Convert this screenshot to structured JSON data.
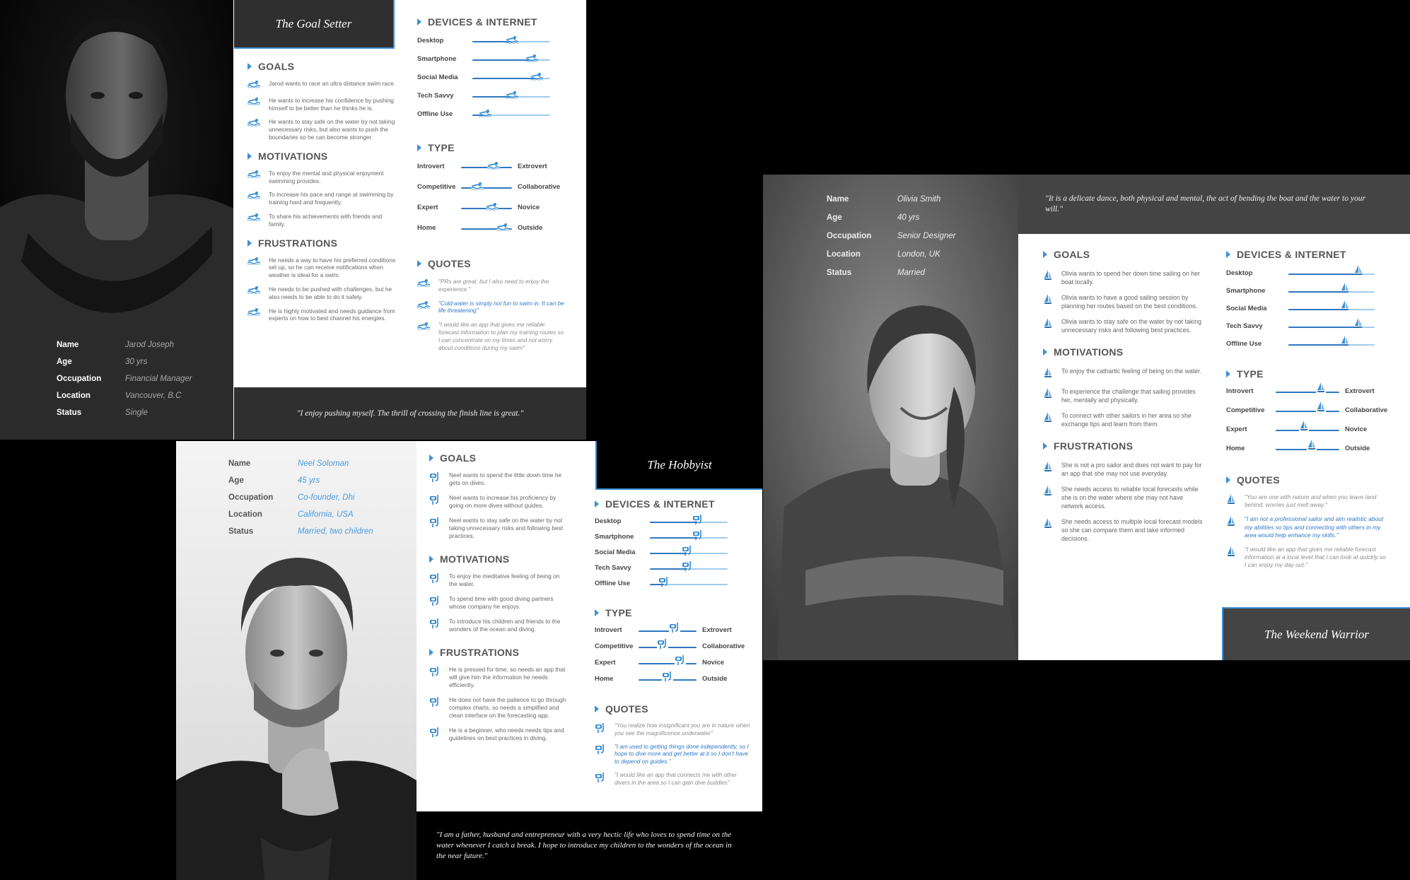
{
  "colors": {
    "accent": "#3b8fd6",
    "dark_panel": "#2f2f2f",
    "card_bg": "#ffffff",
    "hobbyist_value": "#4a9be0"
  },
  "info_keys": [
    "Name",
    "Age",
    "Occupation",
    "Location",
    "Status"
  ],
  "goal_setter": {
    "title": "The Goal Setter",
    "profile": {
      "name": "Jarod Joseph",
      "age": "30 yrs",
      "occupation": "Financial Manager",
      "location": "Vancouver, B.C",
      "status": "Single"
    },
    "sections": {
      "goals": "GOALS",
      "motivations": "MOTIVATIONS",
      "frustrations": "FRUSTRATIONS",
      "devices": "DEVICES & INTERNET",
      "type": "TYPE",
      "quotes": "QUOTES"
    },
    "icon": "swimmer-icon",
    "goals": [
      "Jarod wants to race an ultra distance swim race.",
      "He wants to increase his confidence by pushing himself to be better than he thinks he is.",
      "He wants to stay safe on the water by not taking unnecessary risks, but also wants to push the boundaries so he can become stronger."
    ],
    "motivations": [
      "To enjoy the mental and physical enjoyment swimming provides.",
      "To increase his pace and range at swimming by training hard and frequently.",
      "To share his achievements with friends and family."
    ],
    "frustrations": [
      "He needs a way to have his preferred conditions set up, so he can receive notifications when weather is ideal for a swim.",
      "He needs to be pushed with challenges, but he also needs to be able to do it safely.",
      "He is highly motivated and needs guidance from experts on how to best channel his energies."
    ],
    "devices": [
      {
        "label": "Desktop",
        "level": 0.5
      },
      {
        "label": "Smartphone",
        "level": 0.75
      },
      {
        "label": "Social Media",
        "level": 0.82
      },
      {
        "label": "Tech Savvy",
        "level": 0.5
      },
      {
        "label": "Offline Use",
        "level": 0.15
      }
    ],
    "type": [
      {
        "left": "Introvert",
        "right": "Extrovert",
        "level": 0.62
      },
      {
        "left": "Competitive",
        "right": "Collaborative",
        "level": 0.3
      },
      {
        "left": "Expert",
        "right": "Novice",
        "level": 0.6
      },
      {
        "left": "Home",
        "right": "Outside",
        "level": 0.8
      }
    ],
    "quotes": [
      {
        "text": "\"PRs are great, but I also need to enjoy the experience.\"",
        "highlight": false
      },
      {
        "text": "\"Cold water is simply not fun to swim in. It can be life threatening\"",
        "highlight": true
      },
      {
        "text": "\"I would like an app that gives me reliable forecast information to plan my training routes so I can concentrate on my times and not worry about conditions during my swim\"",
        "highlight": false
      }
    ],
    "footer_quote": "\"I enjoy pushing myself. The thrill of crossing the finish line is great.\""
  },
  "hobbyist": {
    "title": "The Hobbyist",
    "profile": {
      "name": "Neel Soloman",
      "age": "45 yrs",
      "occupation": "Co-founder, Dhi",
      "location": "California, USA",
      "status": "Married, two children"
    },
    "sections": {
      "goals": "GOALS",
      "motivations": "MOTIVATIONS",
      "frustrations": "FRUSTRATIONS",
      "devices": "DEVICES & INTERNET",
      "type": "TYPE",
      "quotes": "QUOTES"
    },
    "icon": "diver-icon",
    "goals": [
      "Neel wants to spend the little down time he gets on dives.",
      "Neel wants to increase his proficiency by going on more dives without guides.",
      "Neel wants to stay safe on the water by not taking unnecessary risks and following best practices."
    ],
    "motivations": [
      "To enjoy the meditative feeling of being on the water.",
      "To spend time with good diving partners whose company he enjoys.",
      "To introduce his children and friends to the wonders of the ocean and diving."
    ],
    "frustrations": [
      "He is pressed for time, so needs an app that will give him the information he needs efficiently.",
      "He does not have the patience to go through complex charts, so needs a simplified and clean interface on the forecasting app.",
      "He is a beginner, who needs needs tips and guidelines on best practices in diving."
    ],
    "devices": [
      {
        "label": "Desktop",
        "level": 0.62
      },
      {
        "label": "Smartphone",
        "level": 0.62
      },
      {
        "label": "Social Media",
        "level": 0.48
      },
      {
        "label": "Tech Savvy",
        "level": 0.48
      },
      {
        "label": "Offline Use",
        "level": 0.18
      }
    ],
    "type": [
      {
        "left": "Introvert",
        "right": "Extrovert",
        "level": 0.62
      },
      {
        "left": "Competitive",
        "right": "Collaborative",
        "level": 0.42
      },
      {
        "left": "Expert",
        "right": "Novice",
        "level": 0.72
      },
      {
        "left": "Home",
        "right": "Outside",
        "level": 0.5
      }
    ],
    "quotes": [
      {
        "text": "\"You realize how insignificant you are in nature when you see the magnificence underwater\"",
        "highlight": false
      },
      {
        "text": "\"I am used to getting things done independently, so I hope to dive more and get better at it so I don't have to depend on guides.\"",
        "highlight": true
      },
      {
        "text": "\"I would like an app that connects me with other divers in the area so I can gain dive buddies\"",
        "highlight": false
      }
    ],
    "footer_quote": "\"I am a father, husband and entrepreneur with a very hectic life who loves to spend time on the water whenever I catch a break. I hope to introduce my children to the wonders of the ocean in the near future.\""
  },
  "weekend_warrior": {
    "title": "The Weekend Warrior",
    "profile": {
      "name": "Olivia Smith",
      "age": "40 yrs",
      "occupation": "Senior Designer",
      "location": "London, UK",
      "status": "Married"
    },
    "sections": {
      "goals": "GOALS",
      "motivations": "MOTIVATIONS",
      "frustrations": "FRUSTRATIONS",
      "devices": "DEVICES & INTERNET",
      "type": "TYPE",
      "quotes": "QUOTES"
    },
    "icon": "sailboat-icon",
    "header_quote": "\"It is a delicate dance, both physical and mental, the act of bending the boat and the water to your will.\"",
    "goals": [
      "Olivia wants to spend her down time sailing on her boat locally.",
      "Olivia wants to have a good sailing session by planning her routes based on the best conditions.",
      "Olivia wants to stay safe on the water by not taking unnecessary risks and following best practices."
    ],
    "motivations": [
      "To enjoy the cathartic feeling of being on the water.",
      "To experience the challenge that sailing provides her, mentally and physically.",
      "To connect with other sailors in her area so she exchange tips and learn from them."
    ],
    "frustrations": [
      "She is not a pro sailor and does not want to pay for an app that she may not use everyday.",
      "She needs access to reliable local forecasts while she is on the water where she may not have network access.",
      "She needs access to multiple local forecast models so she can compare them and take informed decisions."
    ],
    "devices": [
      {
        "label": "Desktop",
        "level": 0.82
      },
      {
        "label": "Smartphone",
        "level": 0.66
      },
      {
        "label": "Social Media",
        "level": 0.66
      },
      {
        "label": "Tech Savvy",
        "level": 0.82
      },
      {
        "label": "Offline Use",
        "level": 0.66
      }
    ],
    "type": [
      {
        "left": "Introvert",
        "right": "Extrovert",
        "level": 0.72
      },
      {
        "left": "Competitive",
        "right": "Collaborative",
        "level": 0.72
      },
      {
        "left": "Expert",
        "right": "Novice",
        "level": 0.45
      },
      {
        "left": "Home",
        "right": "Outside",
        "level": 0.58
      }
    ],
    "quotes": [
      {
        "text": "\"You are one with nature and when you leave land behind, worries just melt away.\"",
        "highlight": false
      },
      {
        "text": "\"I am not a professional sailor and aim realistic about my abilities so tips and connecting with others in my area would help enhance my skills.\"",
        "highlight": true
      },
      {
        "text": "\"I would like an app that gives me reliable forecast information at a local level that I can look at quickly so I can enjoy my day out.\"",
        "highlight": false
      }
    ]
  }
}
